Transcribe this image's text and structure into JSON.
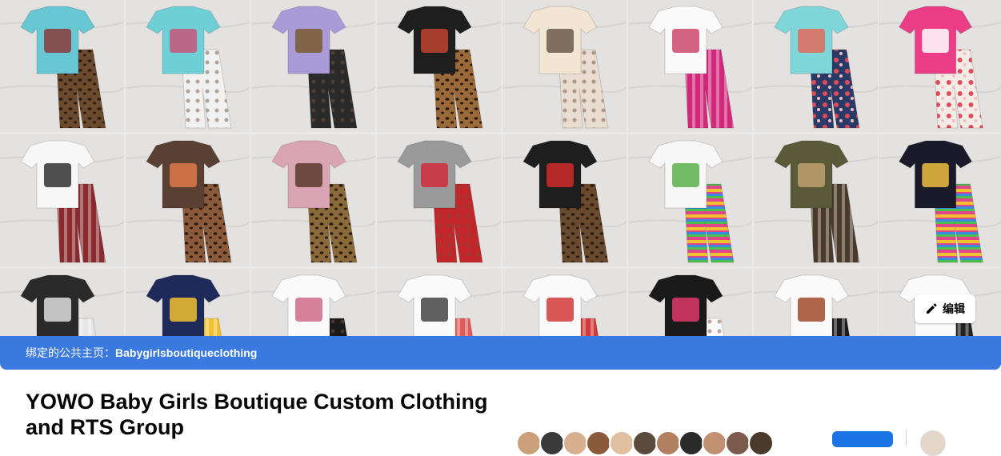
{
  "cover": {
    "edit_label": "编辑",
    "edit_icon": "pencil-icon",
    "linked_prefix": "绑定的公共主页：",
    "linked_page": "Babygirlsboutiqueclothing"
  },
  "group": {
    "title": "YOWO Baby Girls Boutique Custom Clothing and RTS Group",
    "member_avatar_count": 11
  },
  "colors": {
    "accent": "#3a7ae0",
    "primary_button": "#1b74e4",
    "background": "#e9e9e9"
  },
  "products": [
    {
      "top": "#67c7d2",
      "bottom": "#6b4a2e",
      "pattern": "leopard",
      "print": "#8a3b3b"
    },
    {
      "top": "#6fcfd6",
      "bottom": "#f1f1f1",
      "pattern": "dots",
      "print": "#c8557a"
    },
    {
      "top": "#a99ad8",
      "bottom": "#2a2a2a",
      "pattern": "dots",
      "print": "#7b5a2f"
    },
    {
      "top": "#1e1e1e",
      "bottom": "#9a6a3a",
      "pattern": "leopard",
      "print": "#c0432f"
    },
    {
      "top": "#f3e5d3",
      "bottom": "#e8ddd0",
      "pattern": "dots",
      "print": "#6b5a4a"
    },
    {
      "top": "#fafafa",
      "bottom": "#d0287a",
      "pattern": "stripes",
      "print": "#c94a6b"
    },
    {
      "top": "#7fd6d8",
      "bottom": "#2a3a66",
      "pattern": "floral",
      "print": "#e06a5a"
    },
    {
      "top": "#ea3d86",
      "bottom": "#f3ece6",
      "pattern": "floral",
      "print": "#fff"
    },
    {
      "top": "#f7f7f7",
      "bottom": "#8b2a2e",
      "pattern": "stripes",
      "print": "#333"
    },
    {
      "top": "#5a4032",
      "bottom": "#8a5a3a",
      "pattern": "leopard",
      "print": "#e07a4a"
    },
    {
      "top": "#d9a4b4",
      "bottom": "#8a6a3a",
      "pattern": "leopard",
      "print": "#5a3a2a"
    },
    {
      "top": "#9a9a9a",
      "bottom": "#c0262a",
      "pattern": "dots",
      "print": "#d02a3a"
    },
    {
      "top": "#1e1e1e",
      "bottom": "#6a4a2e",
      "pattern": "leopard",
      "print": "#d02a2a"
    },
    {
      "top": "#f7f7f7",
      "bottom": "#e0448a",
      "pattern": "tiedye",
      "print": "#5ab04a"
    },
    {
      "top": "#5a5a3a",
      "bottom": "#4a3a2a",
      "pattern": "stripes",
      "print": "#c0a070"
    },
    {
      "top": "#1a1a2a",
      "bottom": "#e0448a",
      "pattern": "tiedye",
      "print": "#f0c040"
    },
    {
      "top": "#2a2a2a",
      "bottom": "#e6e6e6",
      "pattern": "stripes",
      "print": "#ddd"
    },
    {
      "top": "#1e2a5a",
      "bottom": "#f0c030",
      "pattern": "stripes",
      "print": "#f0c030"
    },
    {
      "top": "#fafafa",
      "bottom": "#1a1a1a",
      "pattern": "dots",
      "print": "#d06a8a"
    },
    {
      "top": "#fafafa",
      "bottom": "#e05a5a",
      "pattern": "stripes",
      "print": "#444"
    },
    {
      "top": "#fafafa",
      "bottom": "#d03a3a",
      "pattern": "stripes",
      "print": "#d03a3a"
    },
    {
      "top": "#1a1a1a",
      "bottom": "#fafafa",
      "pattern": "dots",
      "print": "#e03a6a"
    },
    {
      "top": "#fafafa",
      "bottom": "#1a1a1a",
      "pattern": "stripes",
      "print": "#a04a2a"
    },
    {
      "top": "#fafafa",
      "bottom": "#222222",
      "pattern": "stripes",
      "print": "#777"
    }
  ]
}
